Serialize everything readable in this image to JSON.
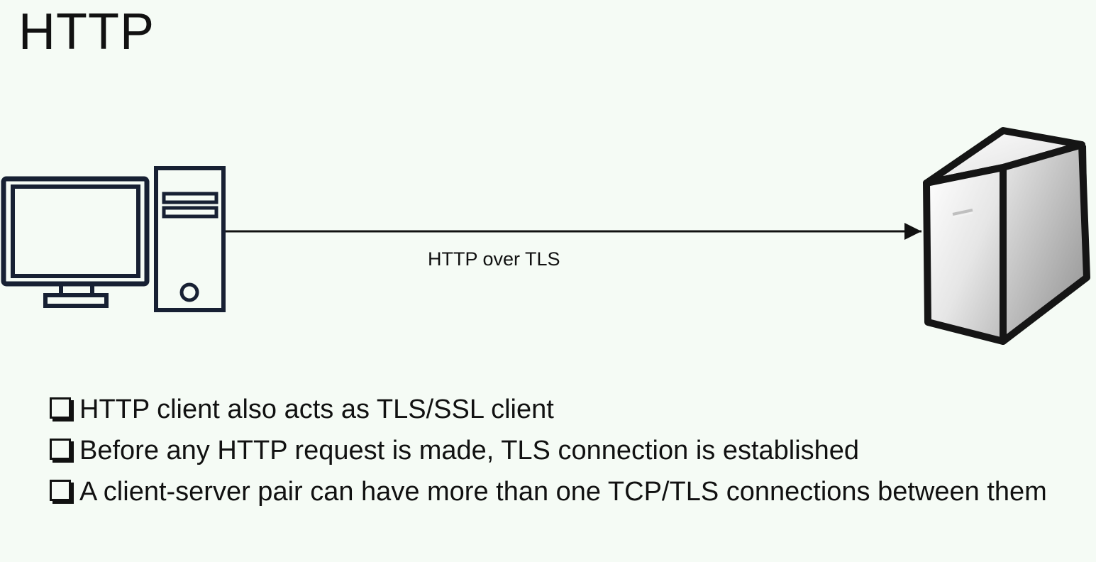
{
  "slide": {
    "title": "HTTP"
  },
  "diagram": {
    "client_icon": "desktop-computer-icon",
    "server_icon": "server-tower-icon",
    "connection_label": "HTTP over TLS"
  },
  "bullets": [
    {
      "marker_icon": "checkbox-icon",
      "text": "HTTP client also acts as TLS/SSL client"
    },
    {
      "marker_icon": "checkbox-icon",
      "text": "Before any HTTP request is made, TLS connection is established"
    },
    {
      "marker_icon": "checkbox-icon",
      "text": "A client-server pair can have more than one TCP/TLS connections between them"
    }
  ]
}
